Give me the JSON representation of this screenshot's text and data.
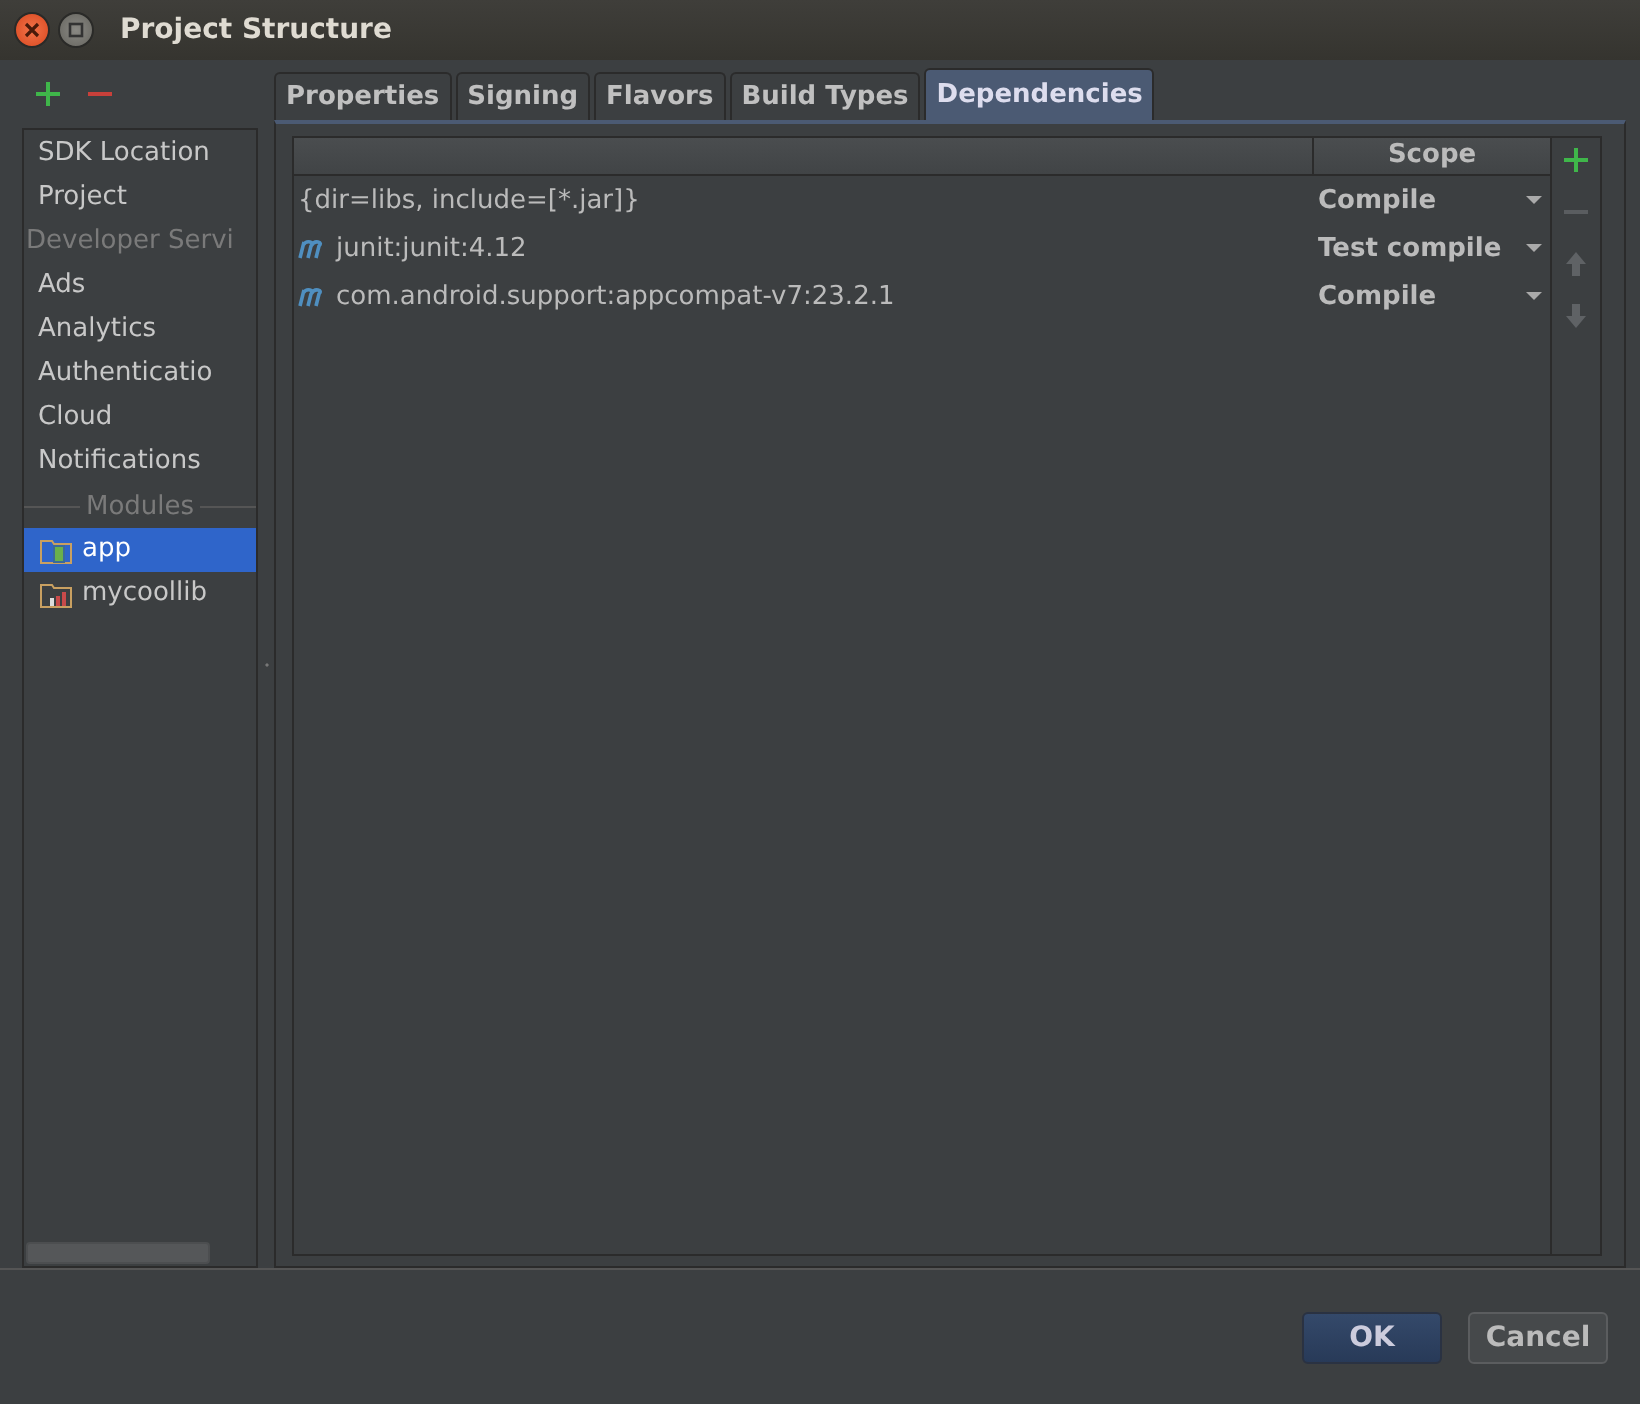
{
  "window": {
    "title": "Project Structure"
  },
  "sidebar": {
    "items": [
      {
        "kind": "item",
        "label": "SDK Location",
        "selected": false
      },
      {
        "kind": "item",
        "label": "Project",
        "selected": false
      },
      {
        "kind": "header",
        "label": "Developer Servi"
      },
      {
        "kind": "item",
        "label": "Ads",
        "selected": false
      },
      {
        "kind": "item",
        "label": "Analytics",
        "selected": false
      },
      {
        "kind": "item",
        "label": "Authenticatio",
        "selected": false
      },
      {
        "kind": "item",
        "label": "Cloud",
        "selected": false
      },
      {
        "kind": "item",
        "label": "Notifications",
        "selected": false
      },
      {
        "kind": "separator",
        "label": "Modules"
      },
      {
        "kind": "app",
        "label": "app",
        "selected": true
      },
      {
        "kind": "library",
        "label": "mycoollib",
        "selected": false
      }
    ]
  },
  "tabs": [
    {
      "label": "Properties",
      "selected": false
    },
    {
      "label": "Signing",
      "selected": false
    },
    {
      "label": "Flavors",
      "selected": false
    },
    {
      "label": "Build Types",
      "selected": false
    },
    {
      "label": "Dependencies",
      "selected": true
    }
  ],
  "table": {
    "columns": [
      "Scope"
    ],
    "rows": [
      {
        "kind": "files",
        "name": "{dir=libs, include=[*.jar]}",
        "scope": "Compile"
      },
      {
        "kind": "maven",
        "name": "junit:junit:4.12",
        "scope": "Test compile"
      },
      {
        "kind": "maven",
        "name": "com.android.support:appcompat-v7:23.2.1",
        "scope": "Compile"
      }
    ]
  },
  "buttons": [
    {
      "label": "OK",
      "kind": "default"
    },
    {
      "label": "Cancel",
      "kind": "normal"
    }
  ]
}
